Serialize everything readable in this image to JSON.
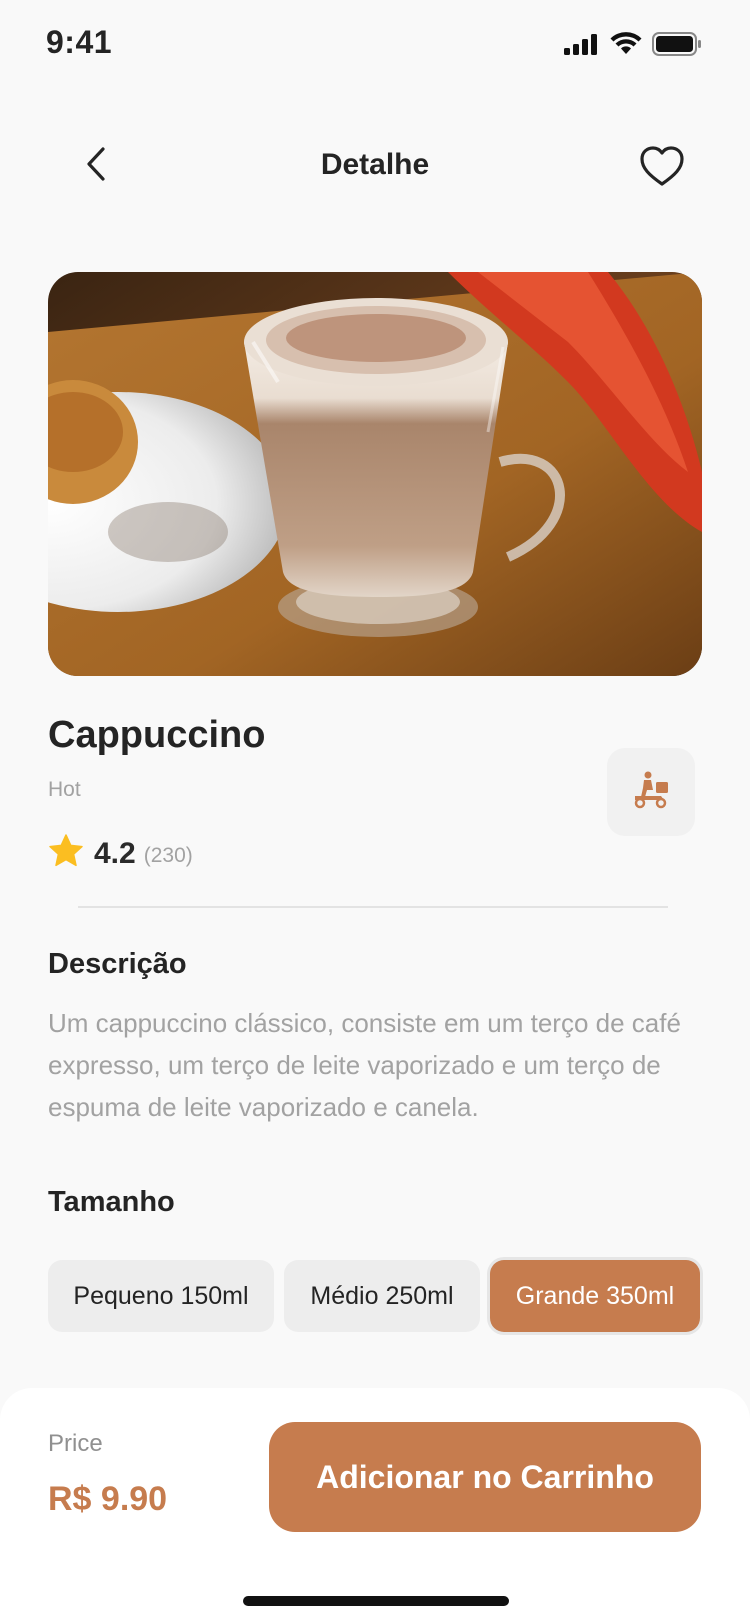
{
  "status_bar": {
    "time": "9:41"
  },
  "header": {
    "title": "Detalhe",
    "back_icon": "chevron-left-icon",
    "favorite_icon": "heart-outline-icon"
  },
  "product": {
    "image_alt": "cappuccino-photo",
    "name": "Cappuccino",
    "variant": "Hot",
    "rating": "4.2",
    "rating_count": "(230)",
    "delivery_icon": "scooter-delivery-icon"
  },
  "description": {
    "title": "Descrição",
    "text": "Um cappuccino clássico, consiste em um terço de café expresso, um terço de leite vaporizado e um terço de espuma de leite vaporizado e canela."
  },
  "size": {
    "title": "Tamanho",
    "options": [
      {
        "label": "Pequeno 150ml",
        "selected": false
      },
      {
        "label": "Médio 250ml",
        "selected": false
      },
      {
        "label": "Grande 350ml",
        "selected": true
      }
    ]
  },
  "footer": {
    "price_label": "Price",
    "price_value": "R$ 9.90",
    "cart_button_label": "Adicionar no Carrinho"
  },
  "colors": {
    "accent": "#C67C4E",
    "background": "#F9F9F9",
    "star": "#FBBE21"
  }
}
